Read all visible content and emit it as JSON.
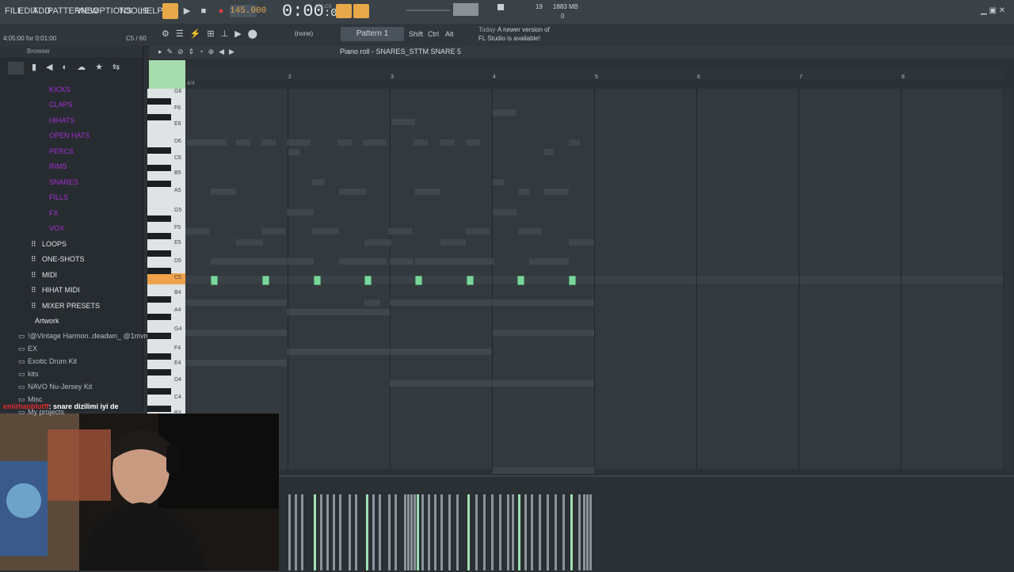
{
  "menu": [
    "FILE",
    "EDIT",
    "ADD",
    "PATTERNS",
    "VIEW",
    "OPTIONS",
    "TOOLS",
    "HELP"
  ],
  "transport": {
    "tempo": "145.000",
    "time": "0:00",
    "time_frac": ":00",
    "time_unit": "M:S:CS",
    "cpu": "19",
    "memory": "1883 MB",
    "polyphony": "0"
  },
  "bar2": {
    "hint": "4:05:00 for 0:01:00",
    "hint_right": "C5 / 60",
    "pattern": "Pattern 1",
    "none_label": "(none)",
    "shift": "Shift",
    "ctrl": "Ctrl",
    "alt": "Alt",
    "news_day": "Today",
    "news_text": "A newer version of",
    "news_text2": "FL Studio is available!"
  },
  "browser": {
    "title": "Browser",
    "items": [
      {
        "label": "KICKS",
        "kind": "purple"
      },
      {
        "label": "CLAPS",
        "kind": "purple"
      },
      {
        "label": "HIHATS",
        "kind": "purple"
      },
      {
        "label": "OPEN HATS",
        "kind": "purple"
      },
      {
        "label": "PERCS",
        "kind": "purple"
      },
      {
        "label": "RIMS",
        "kind": "purple"
      },
      {
        "label": "SNARES",
        "kind": "purple"
      },
      {
        "label": "FILLS",
        "kind": "purple"
      },
      {
        "label": "FX",
        "kind": "purple"
      },
      {
        "label": "VOX",
        "kind": "purple"
      },
      {
        "label": "LOOPS",
        "kind": "white"
      },
      {
        "label": "ONE-SHOTS",
        "kind": "white"
      },
      {
        "label": "MIDI",
        "kind": "white"
      },
      {
        "label": "HIHAT MIDI",
        "kind": "white"
      },
      {
        "label": "MIXER PRESETS",
        "kind": "white"
      },
      {
        "label": "Artwork",
        "kind": "white"
      },
      {
        "label": "!@Vintage Harmon..deadwn_ @1mvnti",
        "kind": "folder"
      },
      {
        "label": "EX",
        "kind": "folder"
      },
      {
        "label": "Exotic Drum Kit",
        "kind": "folder"
      },
      {
        "label": "kits",
        "kind": "folder"
      },
      {
        "label": "NAVO Nu-Jersey Kit",
        "kind": "folder"
      },
      {
        "label": "Misc",
        "kind": "folder"
      },
      {
        "label": "My projects",
        "kind": "folder"
      }
    ]
  },
  "piano_roll": {
    "title": "Piano roll - SNARES_STTM SNARE 5",
    "time_sig": "4/4",
    "ruler": [
      "2",
      "3",
      "4",
      "5",
      "6",
      "7",
      "8"
    ],
    "keys": [
      "G6",
      "F6",
      "E6",
      "D6",
      "C6",
      "B5",
      "A5",
      "G5",
      "F5",
      "E5",
      "D5",
      "C5",
      "B4",
      "A4",
      "G4",
      "F4",
      "E4",
      "D4",
      "C4",
      "B3"
    ],
    "selected_key": "C5"
  },
  "chat": {
    "user": "emirhanblutff",
    "message": ": snare dizilimi iyi de"
  },
  "colors": {
    "note": "#7cd59b",
    "accent": "#f0a24b",
    "purple_folder": "#a52fd6"
  }
}
